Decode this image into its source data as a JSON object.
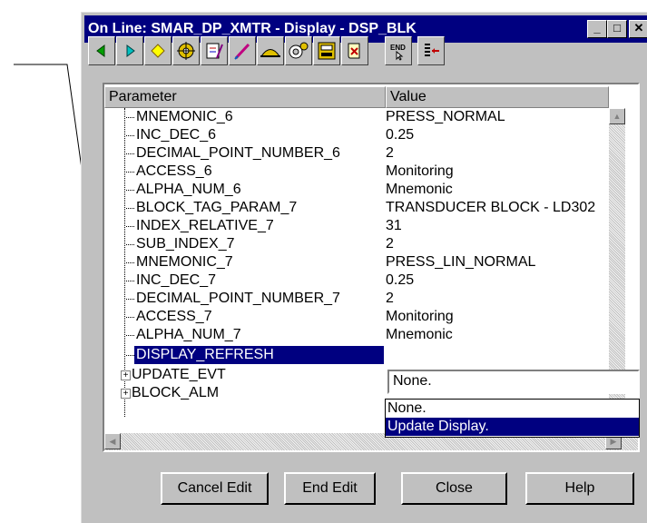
{
  "window": {
    "title": "On Line: SMAR_DP_XMTR - Display - DSP_BLK",
    "controls": {
      "minimize": "_",
      "maximize": "□",
      "close": "✕"
    }
  },
  "toolbar": {
    "icons": [
      "arrow-left-icon",
      "arrow-right-icon",
      "diamond-icon",
      "gear-icon",
      "chart-edit-icon",
      "pen-icon",
      "hat-icon",
      "cloud-gear-icon",
      "monitor-icon",
      "scroll-icon",
      "end-icon",
      "list-icon"
    ]
  },
  "table": {
    "headers": {
      "parameter": "Parameter",
      "value": "Value"
    },
    "rows": [
      {
        "name": "MNEMONIC_6",
        "value": "PRESS_NORMAL"
      },
      {
        "name": "INC_DEC_6",
        "value": "0.25"
      },
      {
        "name": "DECIMAL_POINT_NUMBER_6",
        "value": "2"
      },
      {
        "name": "ACCESS_6",
        "value": "Monitoring"
      },
      {
        "name": "ALPHA_NUM_6",
        "value": "Mnemonic"
      },
      {
        "name": "BLOCK_TAG_PARAM_7",
        "value": "TRANSDUCER BLOCK - LD302"
      },
      {
        "name": "INDEX_RELATIVE_7",
        "value": "31"
      },
      {
        "name": "SUB_INDEX_7",
        "value": "2"
      },
      {
        "name": "MNEMONIC_7",
        "value": "PRESS_LIN_NORMAL"
      },
      {
        "name": "INC_DEC_7",
        "value": "0.25"
      },
      {
        "name": "DECIMAL_POINT_NUMBER_7",
        "value": "2"
      },
      {
        "name": "ACCESS_7",
        "value": "Monitoring"
      },
      {
        "name": "ALPHA_NUM_7",
        "value": "Mnemonic"
      },
      {
        "name": "DISPLAY_REFRESH",
        "value": ""
      },
      {
        "name": "UPDATE_EVT",
        "value": ""
      },
      {
        "name": "BLOCK_ALM",
        "value": ""
      }
    ],
    "expand_glyph": "+"
  },
  "combo": {
    "value": "None."
  },
  "dropdown": {
    "options": [
      "None.",
      "Update Display."
    ],
    "selected": "Update Display."
  },
  "buttons": {
    "cancel_edit": "Cancel Edit",
    "end_edit": "End Edit",
    "close": "Close",
    "help": "Help"
  },
  "colors": {
    "titlebar": "#000080",
    "selection": "#000080",
    "window_face": "#c0c0c0"
  }
}
